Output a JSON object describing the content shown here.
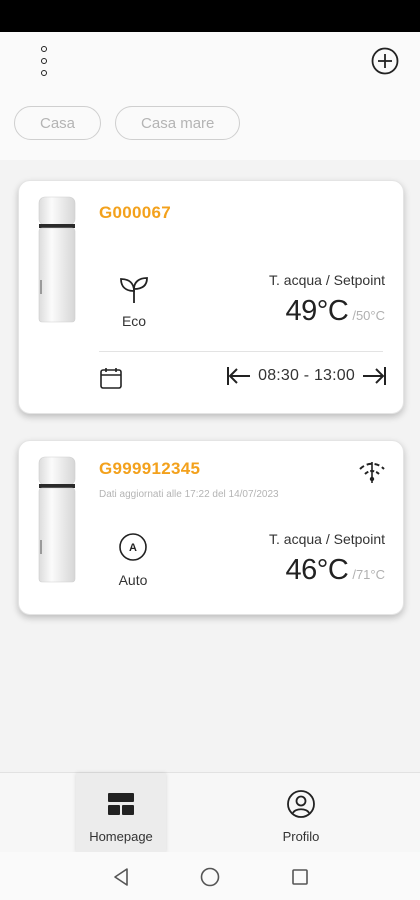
{
  "header": {
    "menu_icon": "more-vertical-icon",
    "add_icon": "plus-circle-icon"
  },
  "locations": [
    {
      "label": "Casa"
    },
    {
      "label": "Casa mare"
    }
  ],
  "devices": [
    {
      "id": "G000067",
      "mode": "Eco",
      "mode_icon": "leaf-icon",
      "temp_label": "T. acqua / Setpoint",
      "temperature": "49°C",
      "setpoint": "/50°C",
      "schedule": "08:30 - 13:00"
    },
    {
      "id": "G999912345",
      "updated": "Dati aggiornati alle 17:22 del 14/07/2023",
      "mode": "Auto",
      "mode_icon": "auto-a-icon",
      "temp_label": "T. acqua / Setpoint",
      "temperature": "46°C",
      "setpoint": "/71°C",
      "connection_icon": "wifi-off-icon"
    }
  ],
  "bottom_nav": [
    {
      "label": "Homepage",
      "icon": "dashboard-icon",
      "active": true
    },
    {
      "label": "Profilo",
      "icon": "user-circle-icon",
      "active": false
    }
  ],
  "colors": {
    "accent": "#f3a11c",
    "chip_text": "#b4b4b4"
  }
}
